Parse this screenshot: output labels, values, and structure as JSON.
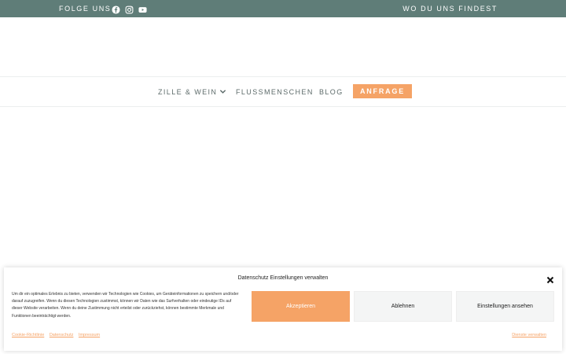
{
  "topbar": {
    "follow_label": "FOLGE UNS",
    "social_icons": [
      "facebook-icon",
      "instagram-icon",
      "youtube-icon"
    ],
    "where_label": "WO DU UNS FINDEST",
    "background": "#5f7d78"
  },
  "nav": {
    "items": [
      {
        "label": "ZILLE & WEIN",
        "has_dropdown": true
      },
      {
        "label": "FLUSSMENSCHEN"
      },
      {
        "label": "BLOG"
      }
    ],
    "cta_label": "ANFRAGE",
    "accent": "#f5a366"
  },
  "cookie": {
    "title": "Datenschutz Einstellungen verwalten",
    "text": "Um dir ein optimales Erlebnis zu bieten, verwenden wir Technologien wie Cookies, um Geräteinformationen zu speichern und/oder darauf zuzugreifen. Wenn du diesen Technologien zustimmst, können wir Daten wie das Surfverhalten oder eindeutige IDs auf dieser Website verarbeiten. Wenn du deine Zustimmung nicht erteilst oder zurückziehst, können bestimmte Merkmale und Funktionen beeinträchtigt werden.",
    "accept_label": "Akzeptieren",
    "deny_label": "Ablehnen",
    "settings_label": "Einstellungen ansehen",
    "links": [
      "Cookie-Richtlinie",
      "Datenschutz",
      "Impressum"
    ],
    "manage_label": "Dienste verwalten"
  }
}
